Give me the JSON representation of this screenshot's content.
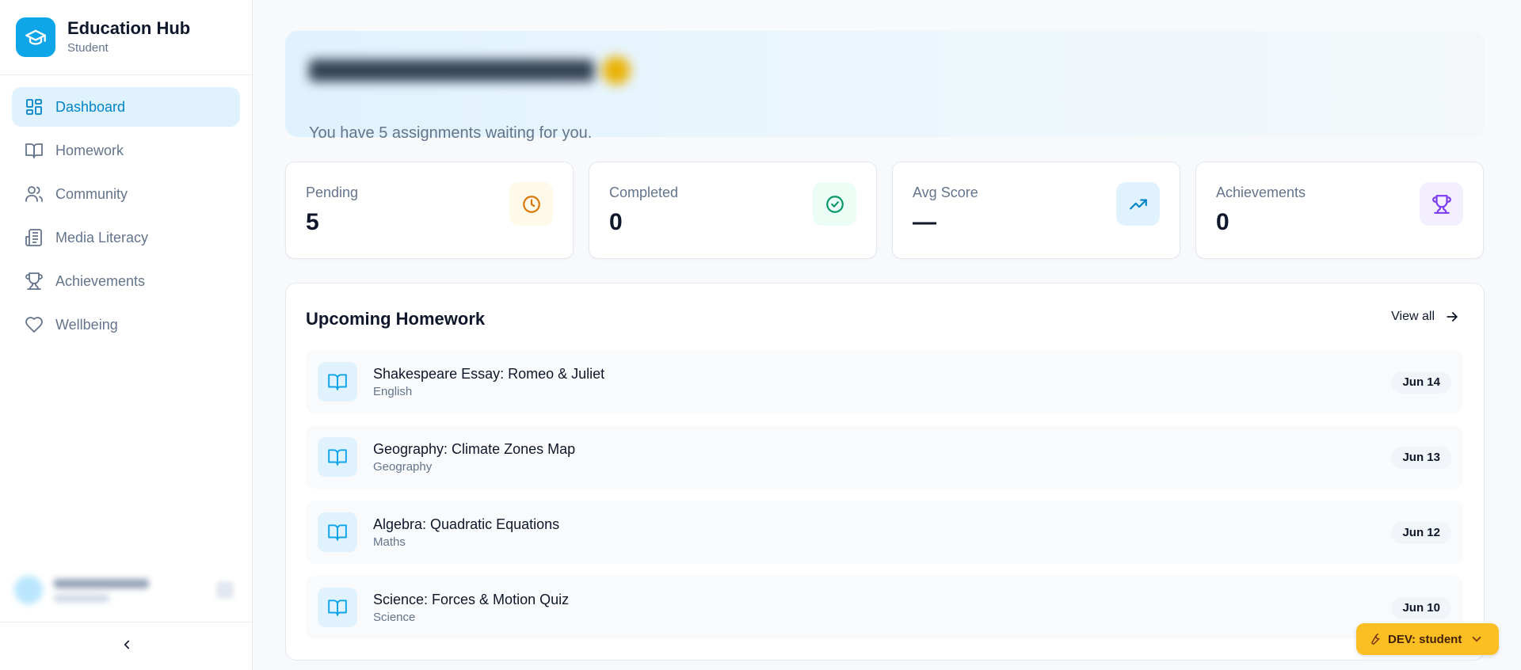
{
  "brand": {
    "title": "Education Hub",
    "subtitle": "Student"
  },
  "nav": {
    "items": [
      {
        "label": "Dashboard",
        "icon": "dashboard-icon",
        "active": true
      },
      {
        "label": "Homework",
        "icon": "book-icon"
      },
      {
        "label": "Community",
        "icon": "users-icon"
      },
      {
        "label": "Media Literacy",
        "icon": "newspaper-icon"
      },
      {
        "label": "Achievements",
        "icon": "trophy-icon"
      },
      {
        "label": "Wellbeing",
        "icon": "heart-icon"
      }
    ]
  },
  "hero": {
    "subtitle": "You have 5 assignments waiting for you."
  },
  "stats": [
    {
      "label": "Pending",
      "value": "5",
      "icon": "clock-icon",
      "color": "#d97706",
      "bg": "#fef9e8"
    },
    {
      "label": "Completed",
      "value": "0",
      "icon": "check-circle-icon",
      "color": "#059669",
      "bg": "#ecfdf5"
    },
    {
      "label": "Avg Score",
      "value": "—",
      "icon": "trending-up-icon",
      "color": "#0284c7",
      "bg": "#e0f2fe"
    },
    {
      "label": "Achievements",
      "value": "0",
      "icon": "trophy-icon",
      "color": "#7c3aed",
      "bg": "#f3efff"
    }
  ],
  "homework": {
    "title": "Upcoming Homework",
    "view_all": "View all",
    "items": [
      {
        "title": "Shakespeare Essay: Romeo & Juliet",
        "subject": "English",
        "due": "Jun 14"
      },
      {
        "title": "Geography: Climate Zones Map",
        "subject": "Geography",
        "due": "Jun 13"
      },
      {
        "title": "Algebra: Quadratic Equations",
        "subject": "Maths",
        "due": "Jun 12"
      },
      {
        "title": "Science: Forces & Motion Quiz",
        "subject": "Science",
        "due": "Jun 10"
      }
    ]
  },
  "dev_switcher": {
    "label": "DEV: student"
  },
  "colors": {
    "accent": "#0ea5e9",
    "accent_dark": "#0284c7",
    "dev": "#fbbf24"
  }
}
